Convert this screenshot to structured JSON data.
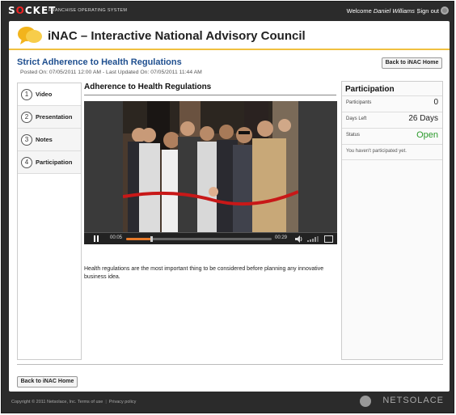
{
  "topbar": {
    "brand_prefix": "S",
    "brand_o": "O",
    "brand_suffix": "CKET",
    "brand_sub": "FRANCHISE OPERATING SYSTEM",
    "welcome_label": "Welcome",
    "user_name": "Daniel Williams",
    "separator": "|",
    "sign_out": "Sign out"
  },
  "header": {
    "title": "iNAC – Interactive National Advisory Council"
  },
  "page": {
    "title": "Strict Adherence to Health Regulations",
    "posted": "Posted On: 07/05/2011 12:00 AM - Last Updated On: 07/05/2011 11:44 AM",
    "back_button_top": "Back to iNAC Home",
    "back_button_bottom": "Back to iNAC Home"
  },
  "tabs": [
    {
      "num": "1",
      "label": "Video"
    },
    {
      "num": "2",
      "label": "Presentation"
    },
    {
      "num": "3",
      "label": "Notes"
    },
    {
      "num": "4",
      "label": "Participation"
    }
  ],
  "content": {
    "title": "Adherence to Health Regulations",
    "description": "Health regulations are the most important thing to be considered before planning any innovative business idea."
  },
  "player": {
    "current_time": "00:05",
    "duration": "00:29",
    "progress_fraction": 0.17
  },
  "participation": {
    "title": "Participation",
    "participants_label": "Participants",
    "participants_value": "0",
    "days_left_label": "Days Left",
    "days_left_value": "26  Days",
    "status_label": "Status",
    "status_value": "Open",
    "note": "You haven't participated yet."
  },
  "footer": {
    "copyright": "Copyright © 2011 Netsolace, Inc.",
    "terms": "Terms of use",
    "separator": "|",
    "privacy": "Privacy policy",
    "brand": "NETSOLACE"
  },
  "colors": {
    "accent_yellow": "#f0c040",
    "title_blue": "#1f4f8f",
    "status_green": "#2a9a2a",
    "progress_orange": "#e87a2a"
  }
}
